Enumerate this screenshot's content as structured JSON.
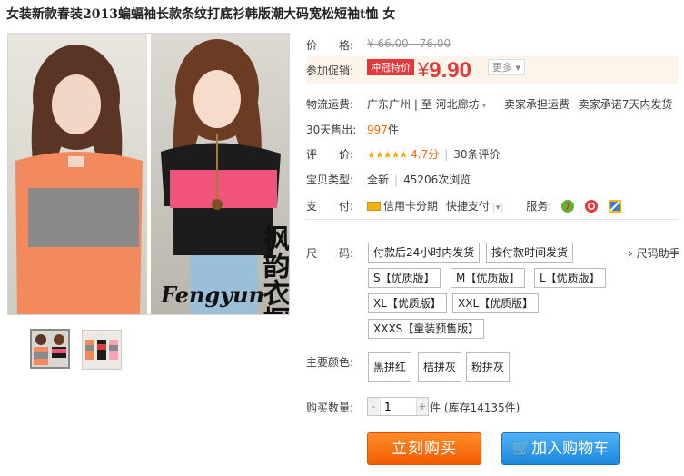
{
  "product": {
    "title": "女装新款春装2013蝙蝠袖长款条纹打底衫韩版潮大码宽松短袖t恤 女"
  },
  "image": {
    "watermark_text": "枫韵衣橱",
    "watermark_brand": "Fengyun"
  },
  "price": {
    "label": "价　　格:",
    "original": "¥ 66.00 - 76.00"
  },
  "promo": {
    "label": "参加促销:",
    "tag": "冲冠特价",
    "currency": "¥",
    "value": "9.90",
    "more": "更多"
  },
  "shipping": {
    "label": "物流运费:",
    "from": "广东广州",
    "separator": "|",
    "to_prefix": "至",
    "to": "河北廊坊",
    "fee": "卖家承担运费",
    "promise": "卖家承诺7天内发货"
  },
  "sales": {
    "label": "30天售出:",
    "count": "997",
    "unit": "件"
  },
  "rating": {
    "label": "评　　价:",
    "stars": "★★★★★",
    "score": "4.7分",
    "reviews": "30条评价"
  },
  "item_type": {
    "label": "宝贝类型:",
    "condition": "全新",
    "views": "45206次浏览"
  },
  "payment": {
    "label": "支　　付:",
    "credit": "信用卡分期",
    "quick": "快捷支付",
    "service_label": "服务:"
  },
  "size": {
    "label": "尺　　码:",
    "helper": "尺码助手",
    "ship_options": [
      "付款后24小时内发货",
      "按付款时间发货"
    ],
    "options": [
      "S【优质版】",
      "M【优质版】",
      "L【优质版】",
      "XL【优质版】",
      "XXL【优质版】",
      "XXXS【童装预售版】"
    ]
  },
  "color": {
    "label": "主要颜色:",
    "options": [
      "黑拼红",
      "桔拼灰",
      "粉拼灰"
    ]
  },
  "quantity": {
    "label": "购买数量:",
    "value": "1",
    "minus": "-",
    "plus": "+",
    "stock": "件 (库存14135件)"
  },
  "actions": {
    "buy_now": "立刻购买",
    "add_to_cart": "加入购物车"
  },
  "colors": {
    "accent_red": "#e4393c",
    "buy_orange": "#f25c00",
    "cart_blue": "#1b88dd"
  }
}
